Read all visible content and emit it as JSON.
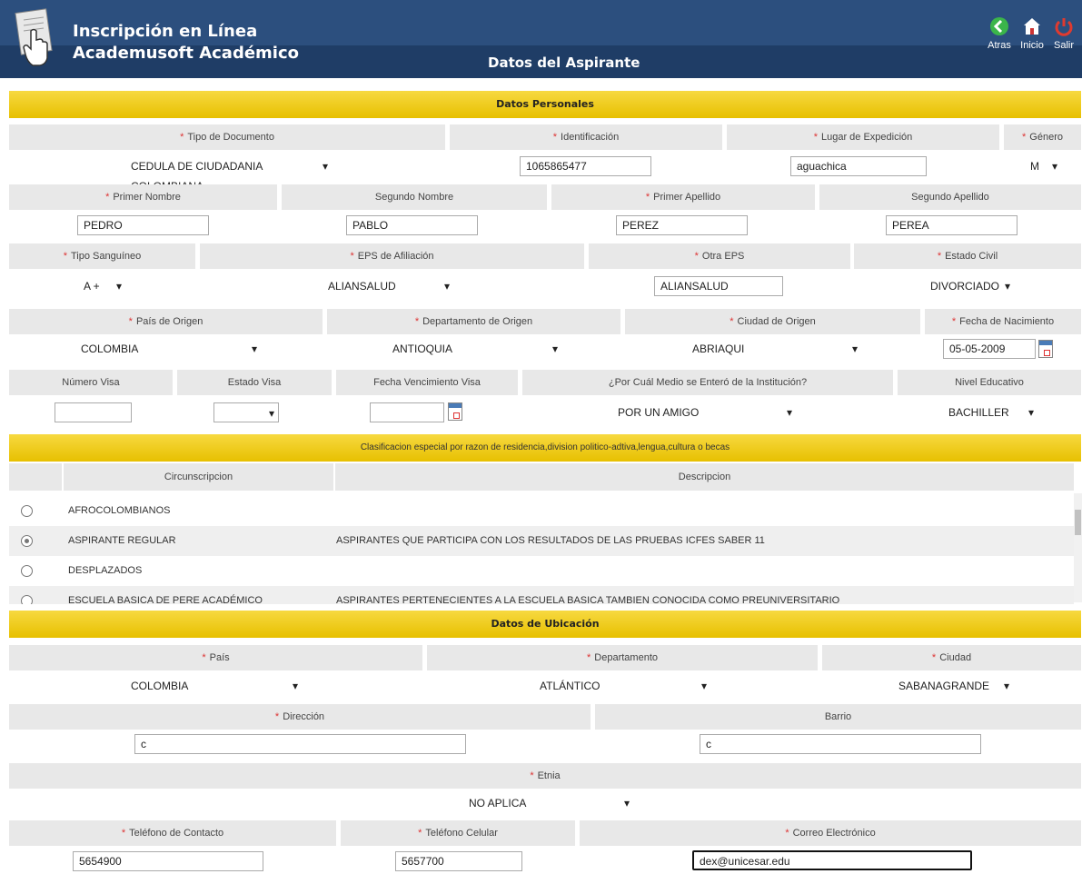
{
  "header": {
    "app_title": "Inscripción en Línea",
    "app_subtitle": "Academusoft Académico",
    "page_title": "Datos del Aspirante",
    "nav": [
      {
        "label": "Atras",
        "icon": "back-arrow-icon",
        "color": "#3bb54a"
      },
      {
        "label": "Inicio",
        "icon": "home-icon",
        "color": "#ffffff"
      },
      {
        "label": "Salir",
        "icon": "power-icon",
        "color": "#e03a2f"
      }
    ]
  },
  "personal": {
    "section_title": "Datos Personales",
    "tipo_doc": {
      "label": "Tipo de Documento",
      "value": "CEDULA DE CIUDADANIA COLOMBIANA"
    },
    "identificacion": {
      "label": "Identificación",
      "value": "1065865477"
    },
    "lugar_expedicion": {
      "label": "Lugar de Expedición",
      "value": "aguachica"
    },
    "genero": {
      "label": "Género",
      "value": "M"
    },
    "primer_nombre": {
      "label": "Primer Nombre",
      "value": "PEDRO"
    },
    "segundo_nombre": {
      "label": "Segundo Nombre",
      "value": "PABLO"
    },
    "primer_apellido": {
      "label": "Primer Apellido",
      "value": "PEREZ"
    },
    "segundo_apellido": {
      "label": "Segundo Apellido",
      "value": "PEREA"
    },
    "tipo_sanguineo": {
      "label": "Tipo Sanguíneo",
      "value": "A +"
    },
    "eps": {
      "label": "EPS de Afiliación",
      "value": "ALIANSALUD"
    },
    "otra_eps": {
      "label": "Otra EPS",
      "value": "ALIANSALUD"
    },
    "estado_civil": {
      "label": "Estado Civil",
      "value": "DIVORCIADO"
    },
    "pais_origen": {
      "label": "País de Origen",
      "value": "COLOMBIA"
    },
    "depto_origen": {
      "label": "Departamento de Origen",
      "value": "ANTIOQUIA"
    },
    "ciudad_origen": {
      "label": "Ciudad de Origen",
      "value": "ABRIAQUI"
    },
    "fecha_nacimiento": {
      "label": "Fecha de Nacimiento",
      "value": "05-05-2009"
    },
    "numero_visa": {
      "label": "Número Visa",
      "value": ""
    },
    "estado_visa": {
      "label": "Estado Visa",
      "value": ""
    },
    "fecha_visa": {
      "label": "Fecha Vencimiento Visa",
      "value": ""
    },
    "medio": {
      "label": "¿Por Cuál Medio se Enteró de la Institución?",
      "value": "POR UN AMIGO"
    },
    "nivel_educativo": {
      "label": "Nivel Educativo",
      "value": "BACHILLER"
    }
  },
  "clasificacion": {
    "section_title": "Clasificacion especial por razon de residencia,division politico-adtiva,lengua,cultura o becas",
    "col_circ": "Circunscripcion",
    "col_desc": "Descripcion",
    "rows": [
      {
        "circ": "AFROCOLOMBIANOS",
        "desc": "",
        "selected": false
      },
      {
        "circ": "ASPIRANTE REGULAR",
        "desc": "ASPIRANTES QUE PARTICIPA CON LOS RESULTADOS DE LAS PRUEBAS ICFES SABER 11",
        "selected": true
      },
      {
        "circ": "DESPLAZADOS",
        "desc": "",
        "selected": false
      },
      {
        "circ": "ESCUELA BASICA DE PERE ACADÉMICO",
        "desc": "ASPIRANTES PERTENECIENTES A LA ESCUELA BASICA TAMBIEN CONOCIDA COMO PREUNIVERSITARIO",
        "selected": false
      }
    ]
  },
  "ubicacion": {
    "section_title": "Datos de Ubicación",
    "pais": {
      "label": "País",
      "value": "COLOMBIA"
    },
    "departamento": {
      "label": "Departamento",
      "value": "ATLÁNTICO"
    },
    "ciudad": {
      "label": "Ciudad",
      "value": "SABANAGRANDE"
    },
    "direccion": {
      "label": "Dirección",
      "value": "c"
    },
    "barrio": {
      "label": "Barrio",
      "value": "c"
    },
    "etnia": {
      "label": "Etnia",
      "value": "NO APLICA"
    },
    "tel_contacto": {
      "label": "Teléfono de Contacto",
      "value": "5654900"
    },
    "tel_celular": {
      "label": "Teléfono Celular",
      "value": "5657700"
    },
    "correo": {
      "label": "Correo Electrónico",
      "value": "dex@unicesar.edu"
    }
  },
  "required_mark": "*",
  "colors": {
    "header_bg": "#1f3d66",
    "section_bar": "#f2cf1f",
    "label_bg": "#e8e8e8",
    "required": "#dd3333"
  }
}
